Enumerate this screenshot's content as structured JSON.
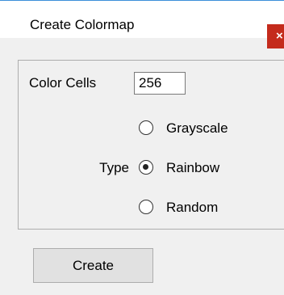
{
  "window": {
    "title": "Create Colormap",
    "close_glyph": "×",
    "close_icon": "close-icon"
  },
  "form": {
    "color_cells_label": "Color Cells",
    "color_cells_value": "256",
    "type_label": "Type",
    "type_options": [
      {
        "label": "Grayscale",
        "selected": false
      },
      {
        "label": "Rainbow",
        "selected": true
      },
      {
        "label": "Random",
        "selected": false
      }
    ]
  },
  "actions": {
    "create_label": "Create"
  },
  "colors": {
    "title_bar_border": "#3c8fd9",
    "close_button": "#c42b1c",
    "panel_background": "#f0f0f0",
    "button_background": "#e1e1e1"
  }
}
